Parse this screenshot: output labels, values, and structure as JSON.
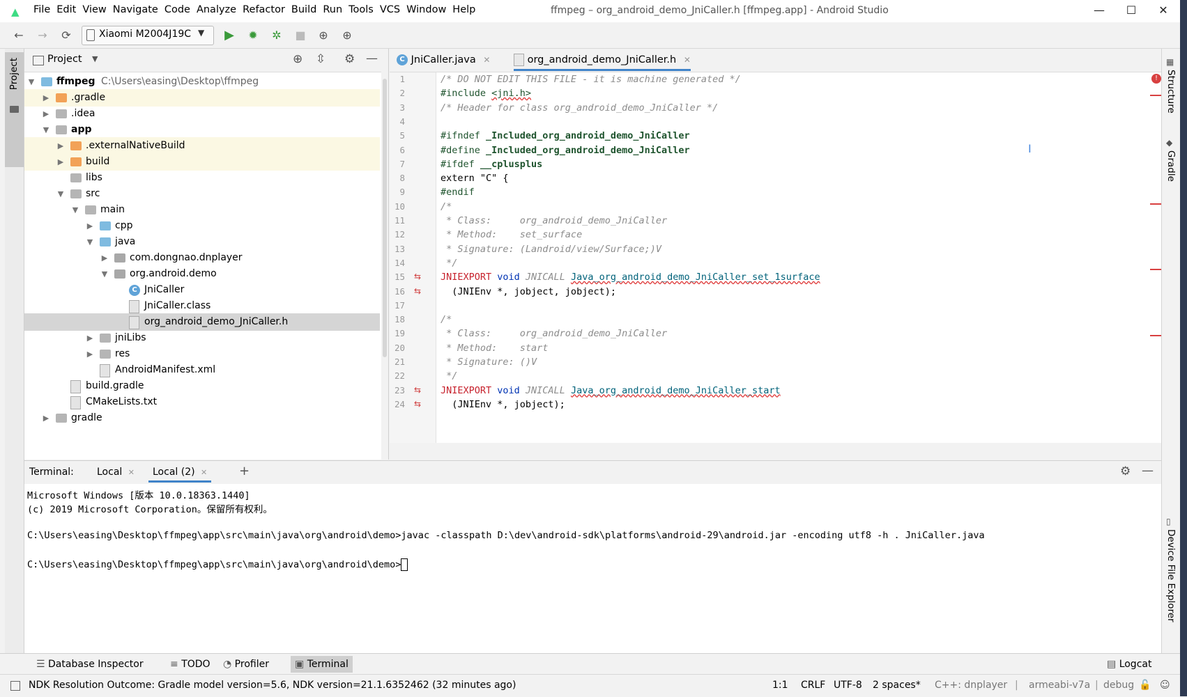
{
  "window": {
    "title": "ffmpeg – org_android_demo_JniCaller.h [ffmpeg.app] - Android Studio",
    "menu": [
      "File",
      "Edit",
      "View",
      "Navigate",
      "Code",
      "Analyze",
      "Refactor",
      "Build",
      "Run",
      "Tools",
      "VCS",
      "Window",
      "Help"
    ],
    "controls": {
      "minimize": "—",
      "maximize": "☐",
      "close": "✕"
    }
  },
  "toolbar": {
    "device": "Xiaomi M2004J19C",
    "icons": [
      "back-icon",
      "forward-icon",
      "sync-icon",
      "device-icon",
      "run-icon",
      "debug-icon",
      "attach-debugger-icon",
      "stop-icon",
      "avd-manager-icon",
      "sdk-manager-icon"
    ]
  },
  "sidebar_left": {
    "project_tab": "Project"
  },
  "project": {
    "view_label": "Project",
    "root": {
      "name": "ffmpeg",
      "path": "C:\\Users\\easing\\Desktop\\ffmpeg"
    },
    "tree": [
      {
        "label": ".gradle",
        "indent": 1,
        "arrow": "▶",
        "icon": "folder-o",
        "hl": true
      },
      {
        "label": ".idea",
        "indent": 1,
        "arrow": "▶",
        "icon": "folder"
      },
      {
        "label": "app",
        "indent": 1,
        "arrow": "▼",
        "icon": "folder",
        "bold": true
      },
      {
        "label": ".externalNativeBuild",
        "indent": 2,
        "arrow": "▶",
        "icon": "folder-o",
        "hl": true
      },
      {
        "label": "build",
        "indent": 2,
        "arrow": "▶",
        "icon": "folder-o",
        "hl": true
      },
      {
        "label": "libs",
        "indent": 2,
        "arrow": "",
        "icon": "folder"
      },
      {
        "label": "src",
        "indent": 2,
        "arrow": "▼",
        "icon": "folder"
      },
      {
        "label": "main",
        "indent": 3,
        "arrow": "▼",
        "icon": "folder"
      },
      {
        "label": "cpp",
        "indent": 4,
        "arrow": "▶",
        "icon": "folder-b"
      },
      {
        "label": "java",
        "indent": 4,
        "arrow": "▼",
        "icon": "folder-b"
      },
      {
        "label": "com.dongnao.dnplayer",
        "indent": 5,
        "arrow": "▶",
        "icon": "folder-p"
      },
      {
        "label": "org.android.demo",
        "indent": 5,
        "arrow": "▼",
        "icon": "folder-p"
      },
      {
        "label": "JniCaller",
        "indent": 6,
        "arrow": "",
        "icon": "class"
      },
      {
        "label": "JniCaller.class",
        "indent": 6,
        "arrow": "",
        "icon": "file"
      },
      {
        "label": "org_android_demo_JniCaller.h",
        "indent": 6,
        "arrow": "",
        "icon": "file",
        "sel": true
      },
      {
        "label": "jniLibs",
        "indent": 4,
        "arrow": "▶",
        "icon": "folder"
      },
      {
        "label": "res",
        "indent": 4,
        "arrow": "▶",
        "icon": "folder"
      },
      {
        "label": "AndroidManifest.xml",
        "indent": 4,
        "arrow": "",
        "icon": "file"
      },
      {
        "label": "build.gradle",
        "indent": 2,
        "arrow": "",
        "icon": "file"
      },
      {
        "label": "CMakeLists.txt",
        "indent": 2,
        "arrow": "",
        "icon": "file"
      },
      {
        "label": "gradle",
        "indent": 1,
        "arrow": "▶",
        "icon": "folder"
      }
    ]
  },
  "editor": {
    "tabs": [
      {
        "label": "JniCaller.java",
        "active": false
      },
      {
        "label": "org_android_demo_JniCaller.h",
        "active": true
      }
    ],
    "lines": [
      {
        "n": "1",
        "segs": [
          {
            "t": "/* DO NOT EDIT THIS FILE - it is machine generated */",
            "c": "cmt"
          }
        ]
      },
      {
        "n": "2",
        "segs": [
          {
            "t": "#include ",
            "c": "pp"
          },
          {
            "t": "<jni.h>",
            "c": "pp wavy"
          }
        ]
      },
      {
        "n": "3",
        "segs": [
          {
            "t": "/* Header for class org_android_demo_JniCaller */",
            "c": "cmt"
          }
        ]
      },
      {
        "n": "4",
        "segs": []
      },
      {
        "n": "5",
        "segs": [
          {
            "t": "#ifndef ",
            "c": "pp"
          },
          {
            "t": "_Included_org_android_demo_JniCaller",
            "c": "pp b"
          }
        ]
      },
      {
        "n": "6",
        "segs": [
          {
            "t": "#define ",
            "c": "pp"
          },
          {
            "t": "_Included_org_android_demo_JniCaller",
            "c": "pp b"
          }
        ]
      },
      {
        "n": "7",
        "segs": [
          {
            "t": "#ifdef ",
            "c": "pp"
          },
          {
            "t": "__cplusplus",
            "c": "pp b"
          }
        ]
      },
      {
        "n": "8",
        "segs": [
          {
            "t": "extern \"C\" {",
            "c": ""
          }
        ]
      },
      {
        "n": "9",
        "segs": [
          {
            "t": "#endif",
            "c": "pp"
          }
        ]
      },
      {
        "n": "10",
        "segs": [
          {
            "t": "/*",
            "c": "cmt"
          }
        ]
      },
      {
        "n": "11",
        "segs": [
          {
            "t": " * Class:     org_android_demo_JniCaller",
            "c": "cmt"
          }
        ]
      },
      {
        "n": "12",
        "segs": [
          {
            "t": " * Method:    set_surface",
            "c": "cmt"
          }
        ]
      },
      {
        "n": "13",
        "segs": [
          {
            "t": " * Signature: (Landroid/view/Surface;)V",
            "c": "cmt"
          }
        ]
      },
      {
        "n": "14",
        "segs": [
          {
            "t": " */",
            "c": "cmt"
          }
        ]
      },
      {
        "n": "15",
        "segs": [
          {
            "t": "JNIEXPORT ",
            "c": "macro"
          },
          {
            "t": "void ",
            "c": "kw"
          },
          {
            "t": "JNICALL ",
            "c": "cmt"
          },
          {
            "t": "Java_org_android_demo_JniCaller_set_1surface",
            "c": "fn"
          }
        ],
        "marker": true
      },
      {
        "n": "16",
        "segs": [
          {
            "t": "  (JNIEnv *, jobject, jobject);",
            "c": ""
          }
        ],
        "marker": true
      },
      {
        "n": "17",
        "segs": []
      },
      {
        "n": "18",
        "segs": [
          {
            "t": "/*",
            "c": "cmt"
          }
        ]
      },
      {
        "n": "19",
        "segs": [
          {
            "t": " * Class:     org_android_demo_JniCaller",
            "c": "cmt"
          }
        ]
      },
      {
        "n": "20",
        "segs": [
          {
            "t": " * Method:    start",
            "c": "cmt"
          }
        ]
      },
      {
        "n": "21",
        "segs": [
          {
            "t": " * Signature: ()V",
            "c": "cmt"
          }
        ]
      },
      {
        "n": "22",
        "segs": [
          {
            "t": " */",
            "c": "cmt"
          }
        ]
      },
      {
        "n": "23",
        "segs": [
          {
            "t": "JNIEXPORT ",
            "c": "macro"
          },
          {
            "t": "void ",
            "c": "kw"
          },
          {
            "t": "JNICALL ",
            "c": "cmt"
          },
          {
            "t": "Java_org_android_demo_JniCaller_start",
            "c": "fn"
          }
        ],
        "marker": true
      },
      {
        "n": "24",
        "segs": [
          {
            "t": "  (JNIEnv *, jobject);",
            "c": ""
          }
        ],
        "marker": true
      }
    ]
  },
  "sidebar_right": {
    "structure": "Structure",
    "gradle": "Gradle",
    "device_explorer": "Device File Explorer"
  },
  "terminal": {
    "label": "Terminal:",
    "tabs": [
      "Local",
      "Local (2)"
    ],
    "add": "+",
    "lines": [
      "Microsoft Windows [版本 10.0.18363.1440]",
      "(c) 2019 Microsoft Corporation。保留所有权利。",
      "",
      "C:\\Users\\easing\\Desktop\\ffmpeg\\app\\src\\main\\java\\org\\android\\demo>javac -classpath D:\\dev\\android-sdk\\platforms\\android-29\\android.jar -encoding utf8 -h . JniCaller.java",
      "",
      "C:\\Users\\easing\\Desktop\\ffmpeg\\app\\src\\main\\java\\org\\android\\demo>"
    ]
  },
  "toolwindows": [
    {
      "label": "Database Inspector",
      "icon": "database-icon"
    },
    {
      "label": "TODO",
      "icon": "list-icon"
    },
    {
      "label": "Profiler",
      "icon": "gauge-icon"
    },
    {
      "label": "Terminal",
      "icon": "terminal-icon",
      "active": true
    }
  ],
  "logcat": "Logcat",
  "status": {
    "message": "NDK Resolution Outcome: Gradle model version=5.6, NDK version=21.1.6352462 (32 minutes ago)",
    "position": "1:1",
    "line_sep": "CRLF",
    "encoding": "UTF-8",
    "indent": "2 spaces*",
    "context": "C++: dnplayer",
    "abi": "armeabi-v7a",
    "variant": "debug"
  }
}
